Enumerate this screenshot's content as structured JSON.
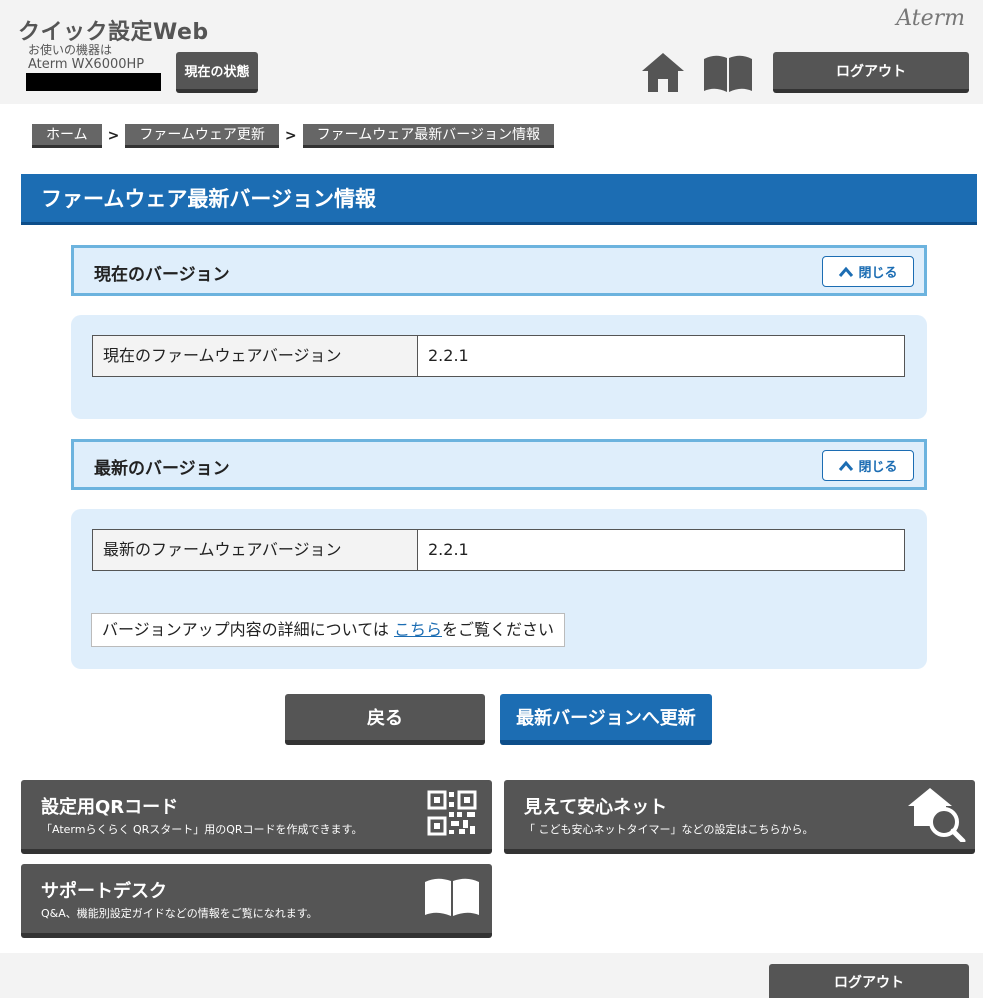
{
  "header": {
    "app_title": "クイック設定Web",
    "device_label": "お使いの機器は",
    "device_name": "Aterm WX6000HP",
    "status_button": "現在の状態",
    "brand": "Aterm",
    "home_icon": "home-icon",
    "manual_icon": "book-icon",
    "logout_button": "ログアウト"
  },
  "breadcrumb": {
    "items": [
      "ホーム",
      "ファームウェア更新",
      "ファームウェア最新バージョン情報"
    ],
    "separator": ">"
  },
  "page_title": "ファームウェア最新バージョン情報",
  "sections": {
    "current": {
      "title": "現在のバージョン",
      "toggle_label": "閉じる",
      "row_label": "現在のファームウェアバージョン",
      "row_value": "2.2.1"
    },
    "latest": {
      "title": "最新のバージョン",
      "toggle_label": "閉じる",
      "row_label": "最新のファームウェアバージョン",
      "row_value": "2.2.1",
      "note_prefix": "バージョンアップ内容の詳細については",
      "note_link": "こちら",
      "note_suffix": "をご覧ください"
    }
  },
  "actions": {
    "back_label": "戻る",
    "update_label": "最新バージョンへ更新"
  },
  "tiles": {
    "qr": {
      "title": "設定用QRコード",
      "desc": "「Atermらくらく QRスタート」用のQRコードを作成できます。",
      "icon": "qr-code-icon"
    },
    "net": {
      "title": "見えて安心ネット",
      "desc": "「 こども安心ネットタイマー」などの設定はこちらから。",
      "icon": "house-search-icon"
    },
    "support": {
      "title": "サポートデスク",
      "desc": "Q&A、機能別設定ガイドなどの情報をご覧になれます。",
      "icon": "book-icon"
    }
  },
  "footer": {
    "logout_button": "ログアウト"
  },
  "colors": {
    "accent_blue": "#1c6db3",
    "section_bg": "#dfeefb",
    "section_border": "#6cb3de",
    "button_gray": "#555555"
  }
}
